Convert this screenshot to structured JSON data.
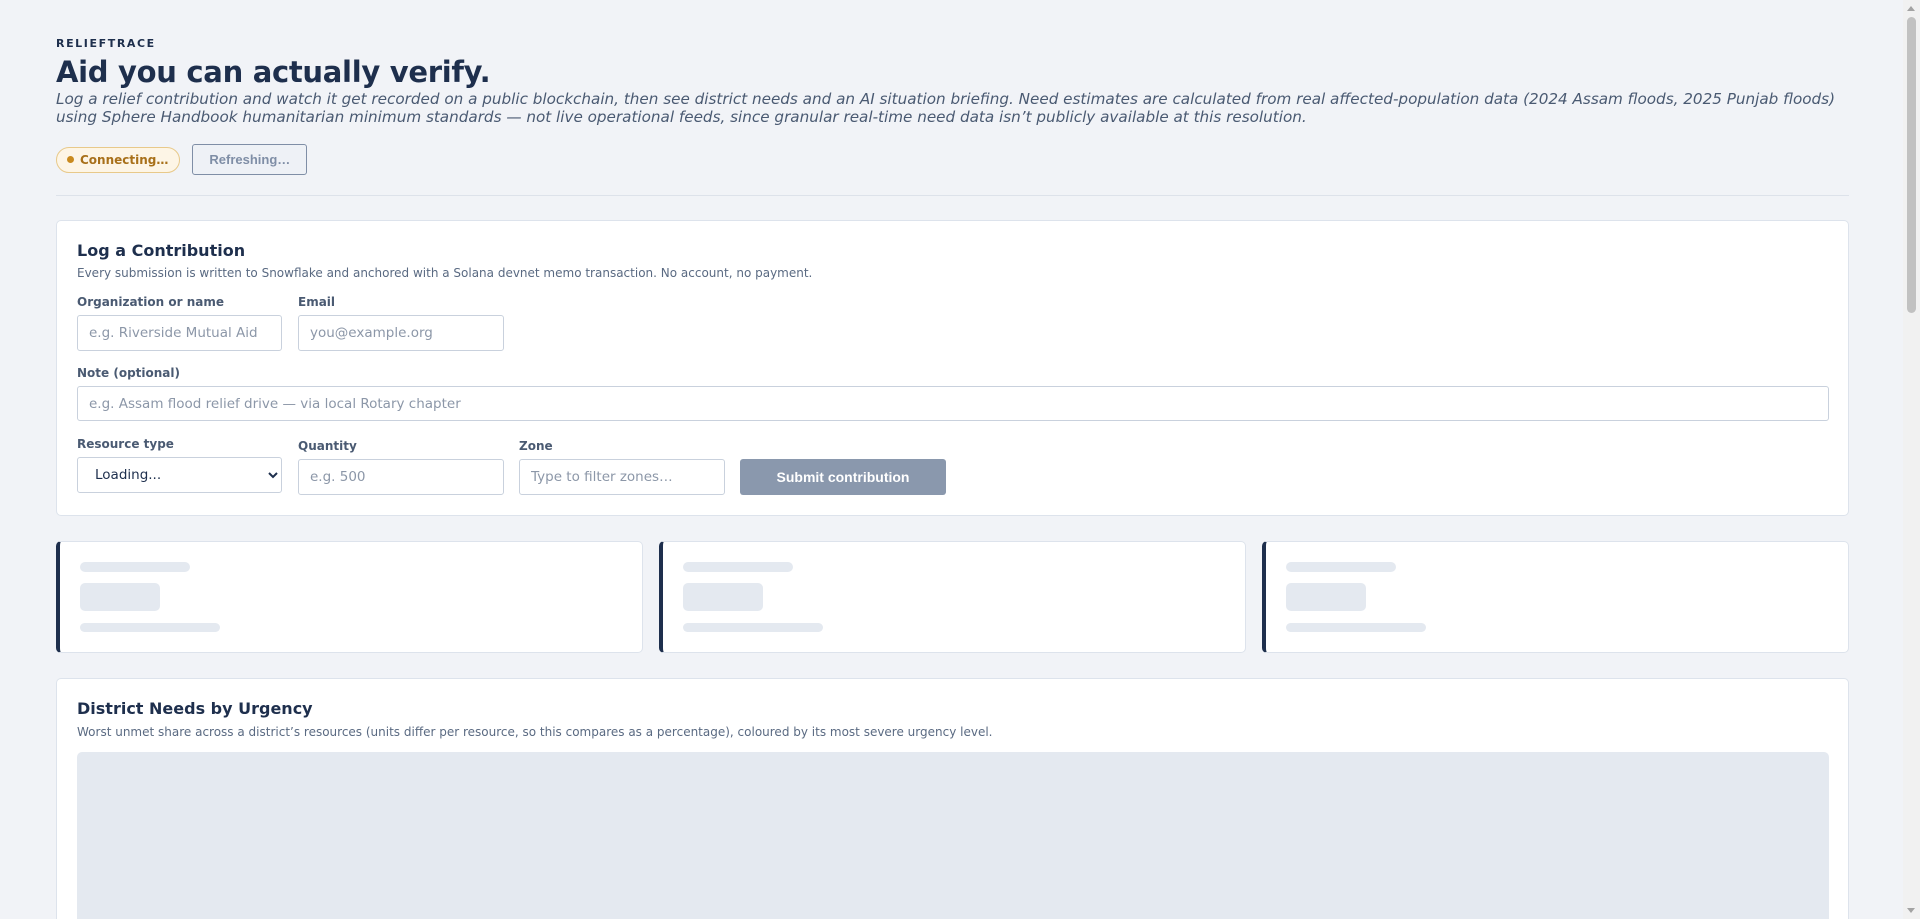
{
  "header": {
    "eyebrow": "RELIEFTRACE",
    "title": "Aid you can actually verify.",
    "subtitle": "Log a relief contribution and watch it get recorded on a public blockchain, then see district needs and an AI situation briefing. Need estimates are calculated from real affected-population data (2024 Assam floods, 2025 Punjab floods) using Sphere Handbook humanitarian minimum standards — not live operational feeds, since granular real-time need data isn’t publicly available at this resolution.",
    "status_label": "Connecting…",
    "refresh_label": "Refreshing…"
  },
  "contribution_form": {
    "title": "Log a Contribution",
    "description": "Every submission is written to Snowflake and anchored with a Solana devnet memo transaction. No account, no payment.",
    "org_label": "Organization or name",
    "org_placeholder": "e.g. Riverside Mutual Aid",
    "email_label": "Email",
    "email_placeholder": "you@example.org",
    "note_label": "Note (optional)",
    "note_placeholder": "e.g. Assam flood relief drive — via local Rotary chapter",
    "resource_label": "Resource type",
    "resource_selected": "Loading...",
    "quantity_label": "Quantity",
    "quantity_placeholder": "e.g. 500",
    "zone_label": "Zone",
    "zone_placeholder": "Type to filter zones…",
    "submit_label": "Submit contribution"
  },
  "district_needs": {
    "title": "District Needs by Urgency",
    "description": "Worst unmet share across a district’s resources (units differ per resource, so this compares as a percentage), coloured by its most severe urgency level."
  },
  "colors": {
    "primary": "#1e2f4d",
    "status_warning": "#c98a1e",
    "skeleton": "#e4e9f0",
    "disabled_button": "#8a98ad"
  }
}
